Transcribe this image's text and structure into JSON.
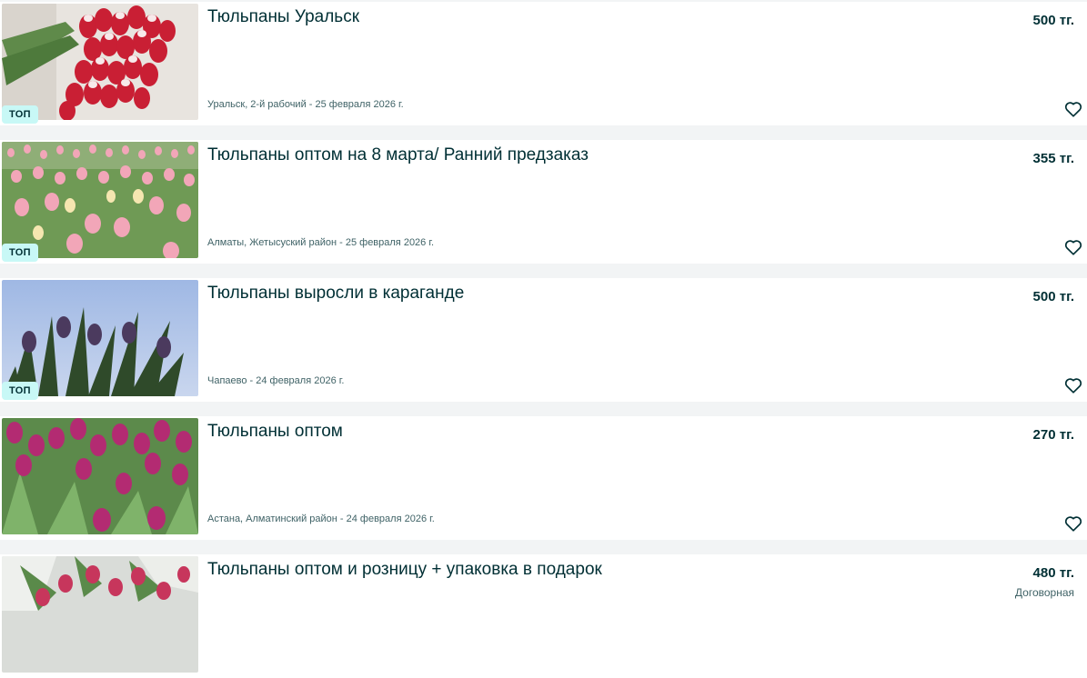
{
  "listings": [
    {
      "title": "Тюльпаны Уральск",
      "price": "500 тг.",
      "meta": "Уральск, 2-й рабочий - 25 февраля 2026 г.",
      "badge": "ТОП",
      "image": "red-white-tulip-bouquet"
    },
    {
      "title": "Тюльпаны оптом на 8 марта/ Ранний предзаказ",
      "price": "355 тг.",
      "meta": "Алматы, Жетысуский район - 25 февраля 2026 г.",
      "badge": "ТОП",
      "image": "pink-tulip-greenhouse-field"
    },
    {
      "title": "Тюльпаны выросли в караганде",
      "price": "500 тг.",
      "meta": "Чапаево - 24 февраля 2026 г.",
      "badge": "ТОП",
      "image": "purple-tulips-against-sky"
    },
    {
      "title": "Тюльпаны оптом",
      "price": "270 тг.",
      "meta": "Астана, Алматинский район - 24 февраля 2026 г.",
      "image": "magenta-tulips-closeup"
    },
    {
      "title": "Тюльпаны оптом и розницу + упаковка в подарок",
      "price": "480 тг.",
      "price_note": "Договорная",
      "image": "wrapped-tulip-bunches"
    }
  ],
  "colors": {
    "background": "#f2f4f5",
    "card": "#ffffff",
    "text": "#002f34",
    "muted": "#406367",
    "badge": "#c8f8f6"
  },
  "icons": {
    "favorite": "heart-outline-icon"
  }
}
